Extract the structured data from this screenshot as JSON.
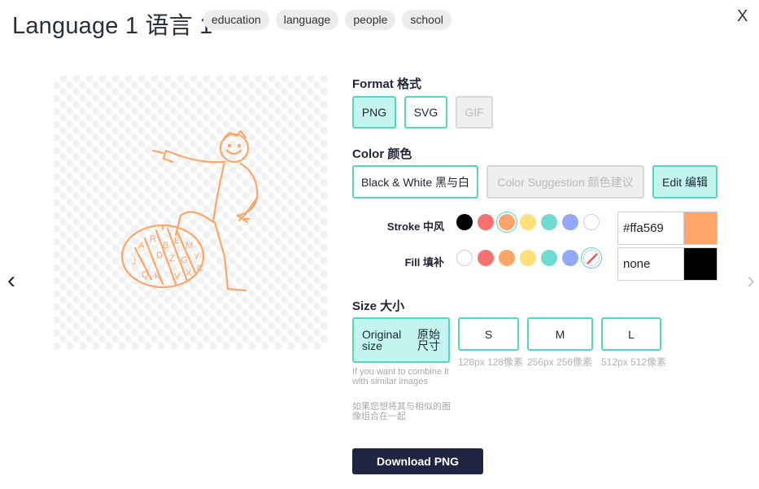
{
  "header": {
    "title": "Language 1 语言 1",
    "tags": [
      "education",
      "language",
      "people",
      "school"
    ],
    "close_label": "X"
  },
  "nav": {
    "prev": "‹",
    "next": "›"
  },
  "format": {
    "label": "Format 格式",
    "options": [
      "PNG",
      "SVG",
      "GIF"
    ],
    "selected": "PNG"
  },
  "color": {
    "label": "Color 颜色",
    "black_white": "Black & White 黑与白",
    "suggestion": "Color Suggestion 颜色建议",
    "edit": "Edit 编辑",
    "stroke_label": "Stroke 中风",
    "fill_label": "Fill 填补",
    "stroke_value": "#ffa569",
    "fill_value": "none",
    "palette": [
      "#000000",
      "#f87171",
      "#ffa569",
      "#fde07a",
      "#6fdccf",
      "#93a8f8",
      "#ffffff"
    ],
    "accent": "#53d7c4"
  },
  "size": {
    "label": "Size 大小",
    "original_en": "Original size",
    "original_cn": "原始 尺寸",
    "options": [
      {
        "label": "S",
        "sub": "128px 128像素"
      },
      {
        "label": "M",
        "sub": "256px 256像素"
      },
      {
        "label": "L",
        "sub": "512px 512像素"
      }
    ],
    "note_en": "If you want to combine it with similar images",
    "note_cn": "如果您想将其与相似的图像组合在一起"
  },
  "download_label": "Download PNG",
  "illustration": {
    "stroke_color": "#ffa569",
    "letters": [
      "A",
      "R",
      "B",
      "E",
      "M",
      "J",
      "D",
      "Z",
      "G",
      "Y",
      "Q",
      "K",
      "V",
      "X",
      "C"
    ]
  }
}
